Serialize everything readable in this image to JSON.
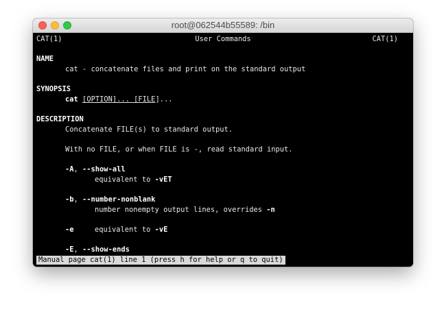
{
  "window": {
    "title": "root@062544b55589: /bin"
  },
  "man": {
    "header_left": "CAT(1)",
    "header_center": "User Commands",
    "header_right": "CAT(1)",
    "name_heading": "NAME",
    "name_text": "cat - concatenate files and print on the standard output",
    "synopsis_heading": "SYNOPSIS",
    "synopsis_cmd": "cat",
    "synopsis_opt_open": "[",
    "synopsis_opt": "OPTION",
    "synopsis_opt_close": "]... ",
    "synopsis_file_open": "[",
    "synopsis_file": "FILE",
    "synopsis_file_close": "]...",
    "description_heading": "DESCRIPTION",
    "desc_line1": "Concatenate FILE(s) to standard output.",
    "desc_line2": "With no FILE, or when FILE is -, read standard input.",
    "opt_A_short": "-A",
    "opt_A_sep": ", ",
    "opt_A_long": "--show-all",
    "opt_A_desc_prefix": "equivalent to ",
    "opt_A_desc_flag": "-vET",
    "opt_b_short": "-b",
    "opt_b_sep": ", ",
    "opt_b_long": "--number-nonblank",
    "opt_b_desc_prefix": "number nonempty output lines, overrides ",
    "opt_b_desc_flag": "-n",
    "opt_e_short": "-e",
    "opt_e_desc_prefix": "equivalent to ",
    "opt_e_desc_flag": "-vE",
    "opt_E_short": "-E",
    "opt_E_sep": ", ",
    "opt_E_long": "--show-ends"
  },
  "status_bar": {
    "text": "Manual page cat(1) line 1 (press h for help or q to quit)"
  },
  "colors": {
    "terminal_bg": "#000000",
    "terminal_fg": "#e8e8e8",
    "status_bg": "#d9d9d9",
    "close": "#fc605c",
    "minimize": "#fdbc40",
    "maximize": "#34c84a"
  }
}
